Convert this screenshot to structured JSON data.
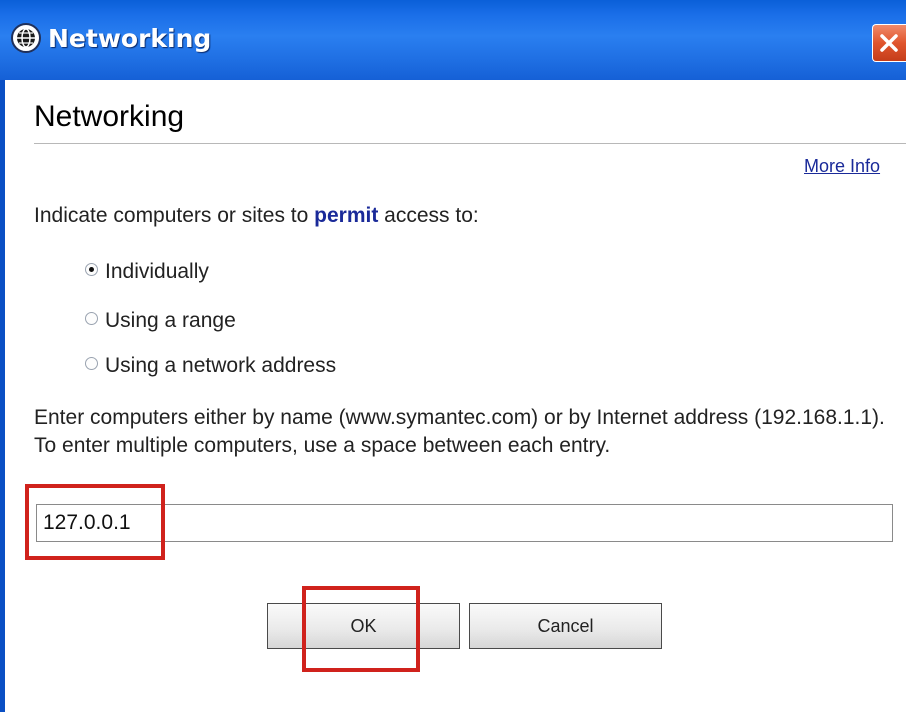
{
  "window": {
    "title": "Networking",
    "title_icon": "globe-icon",
    "close_icon": "close-icon"
  },
  "page": {
    "heading": "Networking",
    "more_info_label": "More Info"
  },
  "prompt": {
    "before": "Indicate computers or sites to ",
    "emphasis": "permit",
    "after": " access to:"
  },
  "access_options": [
    {
      "label": "Individually",
      "selected": true
    },
    {
      "label": "Using a range",
      "selected": false
    },
    {
      "label": "Using a network address",
      "selected": false
    }
  ],
  "instructions": "Enter computers either by name (www.symantec.com) or by Internet address (192.168.1.1). To enter multiple computers, use a space between each entry.",
  "address_field": {
    "value": "127.0.0.1"
  },
  "buttons": {
    "ok_label": "OK",
    "cancel_label": "Cancel"
  },
  "colors": {
    "titlebar": "#1f6fe3",
    "link": "#1a2a99",
    "highlight": "#d0221c"
  }
}
